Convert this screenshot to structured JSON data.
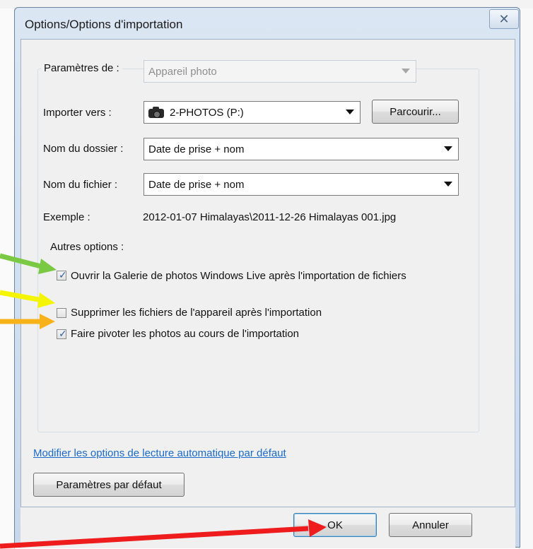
{
  "dialog": {
    "title": "Options/Options d'importation",
    "close_glyph": "✕"
  },
  "settings": {
    "label": "Paramètres de :",
    "value": "Appareil photo"
  },
  "import_to": {
    "label": "Importer vers :",
    "value": "2-PHOTOS (P:)",
    "icon": "camera-icon",
    "browse_label": "Parcourir..."
  },
  "folder_name": {
    "label": "Nom du dossier :",
    "value": "Date de prise + nom"
  },
  "file_name": {
    "label": "Nom du fichier :",
    "value": "Date de prise + nom"
  },
  "example": {
    "label": "Exemple :",
    "value": "2012-01-07 Himalayas\\2011-12-26 Himalayas 001.jpg"
  },
  "other_options": {
    "label": "Autres options :",
    "items": [
      {
        "label": "Ouvrir la Galerie de photos Windows Live après l'importation de fichiers",
        "checked": true
      },
      {
        "label": "Supprimer les fichiers de l'appareil après l'importation",
        "checked": false
      },
      {
        "label": "Faire pivoter les photos au cours de l'importation",
        "checked": true
      }
    ]
  },
  "autoplay_link": "Modifier les options de lecture automatique par défaut",
  "defaults_button": "Paramètres par défaut",
  "ok_button": "OK",
  "cancel_button": "Annuler",
  "annotation_colors": {
    "green": "#7ac943",
    "yellow": "#f5f500",
    "orange": "#f7b21a",
    "red": "#ee1c1c"
  }
}
